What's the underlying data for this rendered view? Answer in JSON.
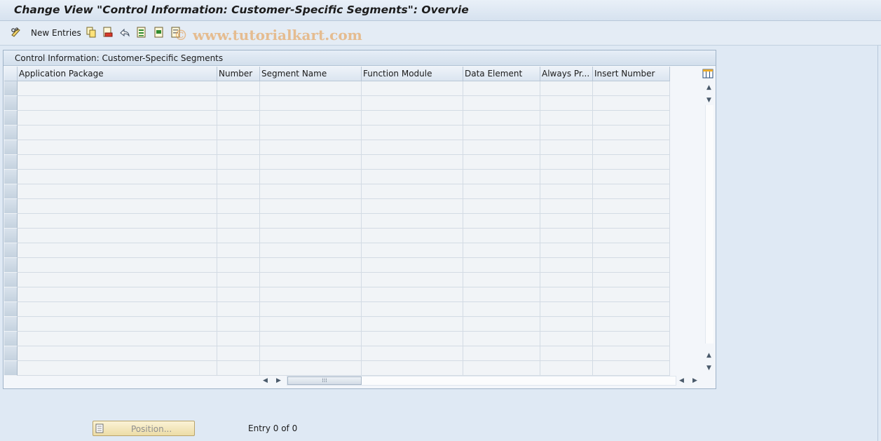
{
  "window": {
    "title": "Change View \"Control Information: Customer-Specific Segments\": Overvie"
  },
  "toolbar": {
    "new_entries_label": "New Entries",
    "icons": [
      "edit-glasses-icon",
      "copy-icon",
      "delete-icon",
      "undo-icon",
      "select-all-icon",
      "select-block-icon",
      "deselect-all-icon"
    ],
    "watermark": "© www.tutorialkart.com"
  },
  "panel": {
    "title": "Control Information: Customer-Specific Segments",
    "columns": [
      "Application Package",
      "Number",
      "Segment Name",
      "Function Module",
      "Data Element",
      "Always Pr...",
      "Insert Number"
    ],
    "rows": [
      [
        "",
        "",
        "",
        "",
        "",
        "",
        ""
      ],
      [
        "",
        "",
        "",
        "",
        "",
        "",
        ""
      ],
      [
        "",
        "",
        "",
        "",
        "",
        "",
        ""
      ],
      [
        "",
        "",
        "",
        "",
        "",
        "",
        ""
      ],
      [
        "",
        "",
        "",
        "",
        "",
        "",
        ""
      ],
      [
        "",
        "",
        "",
        "",
        "",
        "",
        ""
      ],
      [
        "",
        "",
        "",
        "",
        "",
        "",
        ""
      ],
      [
        "",
        "",
        "",
        "",
        "",
        "",
        ""
      ],
      [
        "",
        "",
        "",
        "",
        "",
        "",
        ""
      ],
      [
        "",
        "",
        "",
        "",
        "",
        "",
        ""
      ],
      [
        "",
        "",
        "",
        "",
        "",
        "",
        ""
      ],
      [
        "",
        "",
        "",
        "",
        "",
        "",
        ""
      ],
      [
        "",
        "",
        "",
        "",
        "",
        "",
        ""
      ],
      [
        "",
        "",
        "",
        "",
        "",
        "",
        ""
      ],
      [
        "",
        "",
        "",
        "",
        "",
        "",
        ""
      ],
      [
        "",
        "",
        "",
        "",
        "",
        "",
        ""
      ],
      [
        "",
        "",
        "",
        "",
        "",
        "",
        ""
      ],
      [
        "",
        "",
        "",
        "",
        "",
        "",
        ""
      ],
      [
        "",
        "",
        "",
        "",
        "",
        "",
        ""
      ],
      [
        "",
        "",
        "",
        "",
        "",
        "",
        ""
      ]
    ]
  },
  "footer": {
    "position_button_label": "Position...",
    "entry_info": "Entry 0 of 0"
  },
  "colors": {
    "background": "#dfe9f4",
    "position_button": "#f4e9bf"
  }
}
